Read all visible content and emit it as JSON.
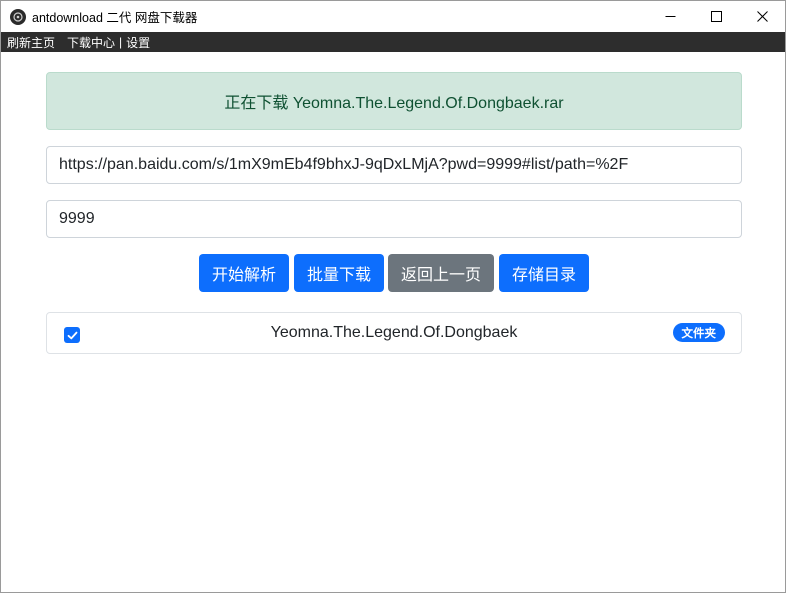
{
  "window": {
    "title": "antdownload 二代 网盘下载器",
    "controls": [
      "minimize-icon",
      "maximize-icon",
      "close-icon"
    ]
  },
  "menu": {
    "items": [
      {
        "label": "刷新主页"
      },
      {
        "label": "下载中心"
      },
      {
        "label": "设置"
      }
    ],
    "separator": "|"
  },
  "status": {
    "text": "正在下载 Yeomna.The.Legend.Of.Dongbaek.rar"
  },
  "inputs": {
    "url_value": "https://pan.baidu.com/s/1mX9mEb4f9bhxJ-9qDxLMjA?pwd=9999#list/path=%2F",
    "password_value": "9999"
  },
  "actions": {
    "parse_label": "开始解析",
    "batch_label": "批量下载",
    "back_label": "返回上一页",
    "directory_label": "存储目录"
  },
  "files": [
    {
      "name": "Yeomna.The.Legend.Of.Dongbaek",
      "checked": true,
      "badge": "文件夹"
    }
  ],
  "colors": {
    "primary": "#0d6efd",
    "secondary": "#6c757d",
    "alert_bg": "#d1e7dd",
    "alert_text": "#0f5132",
    "menubar_bg": "#2d2d2d"
  }
}
